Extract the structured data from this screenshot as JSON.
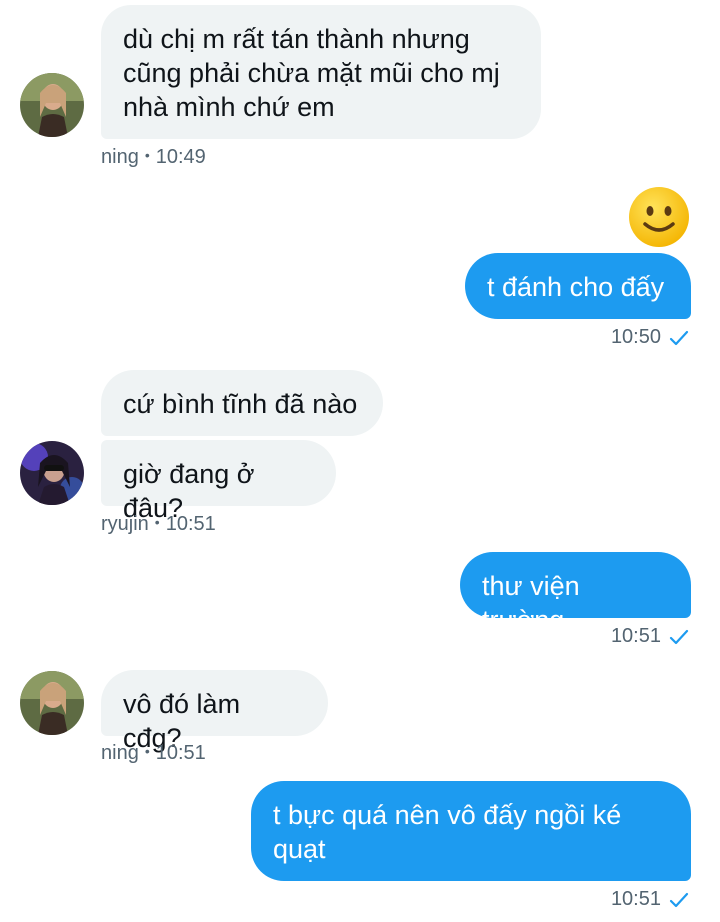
{
  "messages": [
    {
      "side": "in",
      "text": "dù chị m rất tán thành nhưng cũng phải chừa mặt mũi cho mj nhà mình chứ em"
    },
    {
      "side": "in_meta",
      "sender": "ning",
      "time": "10:49"
    },
    {
      "side": "out",
      "emoji": "🙂"
    },
    {
      "side": "out",
      "text": "t đánh cho đấy",
      "time": "10:50"
    },
    {
      "side": "in",
      "text": "cứ bình tĩnh đã nào"
    },
    {
      "side": "in",
      "text": "giờ đang ở đâu?"
    },
    {
      "side": "in_meta",
      "sender": "ryujin",
      "time": "10:51"
    },
    {
      "side": "out",
      "text": "thư viện trường",
      "time": "10:51"
    },
    {
      "side": "in",
      "text": "vô đó làm cđg?"
    },
    {
      "side": "in_meta",
      "sender": "ning",
      "time": "10:51"
    },
    {
      "side": "out",
      "text": "t bực quá nên vô đấy ngồi ké quạt",
      "time": "10:51"
    }
  ],
  "chat": {
    "m1": "dù chị m rất tán thành nhưng\ncũng phải chừa mặt mũi cho mj\nnhà mình chứ em",
    "m1_sender": "ning",
    "m1_time": "10:49",
    "emoji": "🙂",
    "m2": "t đánh cho đấy",
    "m2_time": "10:50",
    "m3": "cứ bình tĩnh đã nào",
    "m4": "giờ đang ở đâu?",
    "m4_sender": "ryujin",
    "m4_time": "10:51",
    "m5": "thư viện trường",
    "m5_time": "10:51",
    "m6": "vô đó làm cđg?",
    "m6_sender": "ning",
    "m6_time": "10:51",
    "m7": "t bực quá nên vô đấy ngồi ké\nquạt",
    "m7_time": "10:51",
    "separator": "•"
  },
  "colors": {
    "outgoing_bubble": "#1d9bf0",
    "incoming_bubble": "#eff3f4",
    "meta_text": "#536471",
    "check": "#1d9bf0"
  }
}
